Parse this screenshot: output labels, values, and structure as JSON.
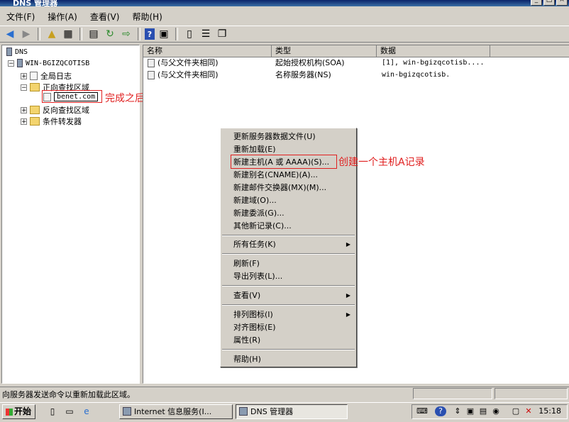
{
  "window": {
    "title": "DNS 管理器"
  },
  "menu": [
    "文件(F)",
    "操作(A)",
    "查看(V)",
    "帮助(H)"
  ],
  "toolbar_icons": [
    "back-icon",
    "forward-icon",
    "up-folder-icon",
    "show-tree-icon",
    "properties-icon",
    "refresh-icon",
    "export-icon",
    "help-icon",
    "console-icon",
    "server-icon",
    "list-icon",
    "copy-icon"
  ],
  "tree": {
    "root": "DNS",
    "server": "WIN-BGIZQCOTISB",
    "global_logs": "全局日志",
    "forward_zones": "正向查找区域",
    "zone": "benet.com",
    "reverse_zones": "反向查找区域",
    "conditional_forwarders": "条件转发器"
  },
  "annotations": {
    "zone_note": "完成之后在正向区域里面就会显示",
    "host_note": "创建一个主机A记录"
  },
  "columns": [
    "名称",
    "类型",
    "数据"
  ],
  "rows": [
    {
      "name": "(与父文件夹相同)",
      "type": "起始授权机构(SOA)",
      "data": "[1], win-bgizqcotisb...."
    },
    {
      "name": "(与父文件夹相同)",
      "type": "名称服务器(NS)",
      "data": "win-bgizqcotisb."
    }
  ],
  "context_menu": {
    "update_server_file": "更新服务器数据文件(U)",
    "reload": "重新加载(E)",
    "new_host": "新建主机(A 或 AAAA)(S)...",
    "new_alias": "新建别名(CNAME)(A)...",
    "new_mx": "新建邮件交换器(MX)(M)...",
    "new_domain": "新建域(O)...",
    "new_delegation": "新建委派(G)...",
    "other_records": "其他新记录(C)...",
    "all_tasks": "所有任务(K)",
    "refresh": "刷新(F)",
    "export_list": "导出列表(L)...",
    "view": "查看(V)",
    "arrange_icons": "排列图标(I)",
    "line_up_icons": "对齐图标(E)",
    "properties": "属性(R)",
    "help": "帮助(H)"
  },
  "status": {
    "text": "向服务器发送命令以重新加载此区域。"
  },
  "taskbar": {
    "start": "开始",
    "tasks": [
      {
        "label": "Internet 信息服务(I..."
      },
      {
        "label": "DNS 管理器"
      }
    ],
    "clock": "15:18"
  }
}
